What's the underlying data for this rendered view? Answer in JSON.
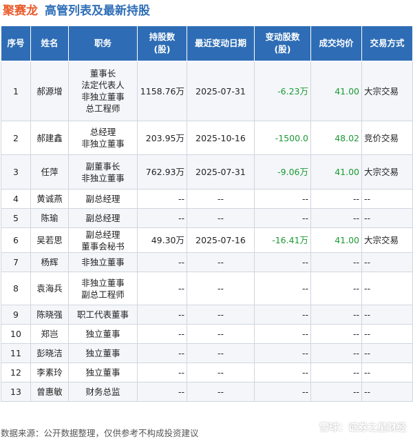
{
  "title": {
    "company": "聚赛龙",
    "heading": "高管列表及最新持股"
  },
  "columns": [
    "序号",
    "姓名",
    "职务",
    "持股数\n(股)",
    "最近变动日期",
    "变动股数\n(股)",
    "成交均价",
    "交易方式"
  ],
  "rows": [
    {
      "no": "1",
      "name": "郝源增",
      "roles": [
        "董事长",
        "法定代表人",
        "非独立董事",
        "总工程师"
      ],
      "shares": "1158.76万",
      "date": "2025-07-31",
      "change": "-6.23万",
      "price": "41.00",
      "method": "大宗交易"
    },
    {
      "no": "2",
      "name": "郝建鑫",
      "roles": [
        "总经理",
        "非独立董事"
      ],
      "shares": "203.95万",
      "date": "2025-10-16",
      "change": "-1500.0",
      "price": "48.02",
      "method": "竞价交易"
    },
    {
      "no": "3",
      "name": "任萍",
      "roles": [
        "副董事长",
        "非独立董事"
      ],
      "shares": "762.93万",
      "date": "2025-07-31",
      "change": "-9.06万",
      "price": "41.00",
      "method": "大宗交易"
    },
    {
      "no": "4",
      "name": "黄诚燕",
      "roles": [
        "副总经理"
      ],
      "shares": "--",
      "date": "--",
      "change": "--",
      "price": "--",
      "method": "--"
    },
    {
      "no": "5",
      "name": "陈瑜",
      "roles": [
        "副总经理"
      ],
      "shares": "--",
      "date": "--",
      "change": "--",
      "price": "--",
      "method": "--"
    },
    {
      "no": "6",
      "name": "吴若思",
      "roles": [
        "副总经理",
        "董事会秘书"
      ],
      "shares": "49.30万",
      "date": "2025-07-16",
      "change": "-16.41万",
      "price": "41.00",
      "method": "大宗交易"
    },
    {
      "no": "7",
      "name": "杨辉",
      "roles": [
        "非独立董事"
      ],
      "shares": "--",
      "date": "--",
      "change": "--",
      "price": "--",
      "method": "--"
    },
    {
      "no": "8",
      "name": "袁海兵",
      "roles": [
        "非独立董事",
        "副总工程师"
      ],
      "shares": "--",
      "date": "--",
      "change": "--",
      "price": "--",
      "method": "--"
    },
    {
      "no": "9",
      "name": "陈晓强",
      "roles": [
        "职工代表董事"
      ],
      "shares": "--",
      "date": "--",
      "change": "--",
      "price": "--",
      "method": "--"
    },
    {
      "no": "10",
      "name": "郑岂",
      "roles": [
        "独立董事"
      ],
      "shares": "--",
      "date": "--",
      "change": "--",
      "price": "--",
      "method": "--"
    },
    {
      "no": "11",
      "name": "彭晓洁",
      "roles": [
        "独立董事"
      ],
      "shares": "--",
      "date": "--",
      "change": "--",
      "price": "--",
      "method": "--"
    },
    {
      "no": "12",
      "name": "李素玲",
      "roles": [
        "独立董事"
      ],
      "shares": "--",
      "date": "--",
      "change": "--",
      "price": "--",
      "method": "--"
    },
    {
      "no": "13",
      "name": "曾惠敏",
      "roles": [
        "财务总监"
      ],
      "shares": "--",
      "date": "--",
      "change": "--",
      "price": "--",
      "method": "--"
    }
  ],
  "footer": {
    "source": "数据来源：公开数据整理，仅供参考不构成投资建议",
    "brand": "雪球：证券之星财经"
  },
  "watermark": "证券之星",
  "colors": {
    "header_bg": "#2e6db5",
    "company": "#e85a2a",
    "heading": "#2f6fb8",
    "change": "#1a9a33"
  }
}
